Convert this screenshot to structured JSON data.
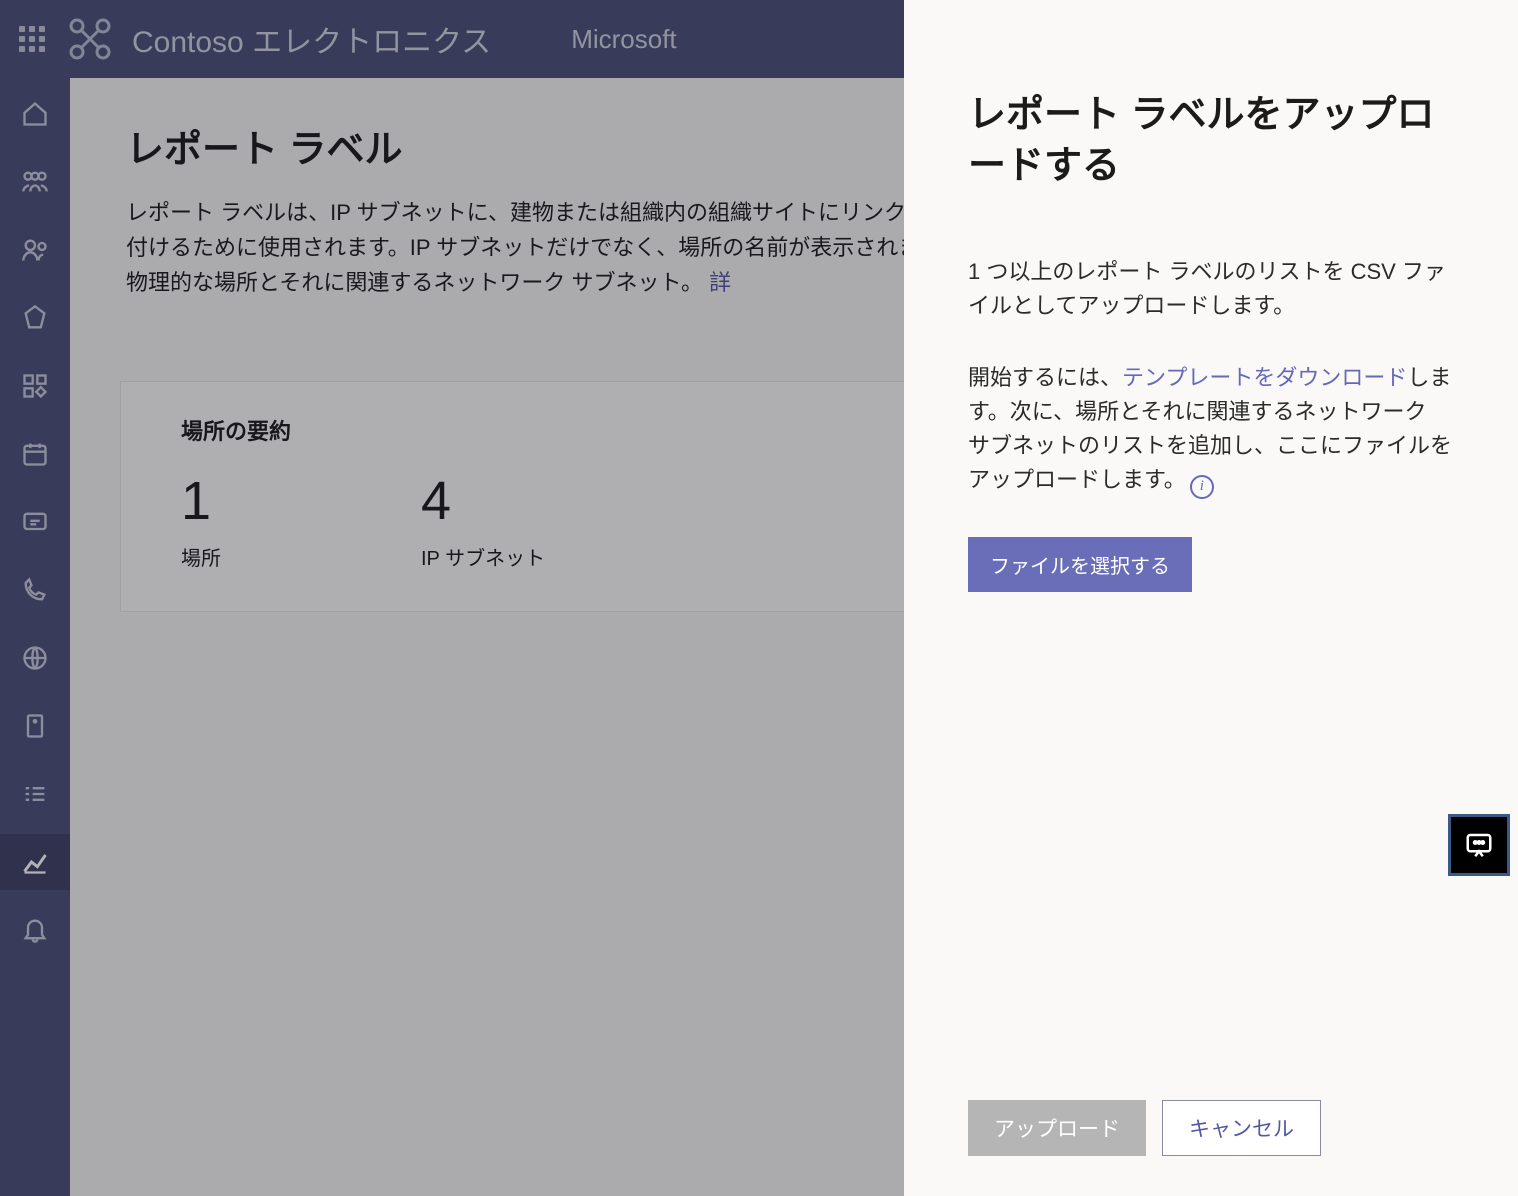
{
  "header": {
    "brand": "Contoso エレクトロニクス",
    "msft": "Microsoft"
  },
  "main": {
    "title": "レポート ラベル",
    "description": "レポート ラベルは、IP サブネットに、建物または組織内の組織サイトにリンクする名前を付けるために使用されます。IP サブネットだけでなく、場所の名前が表示されます。自分物理的な場所とそれに関連するネットワーク サブネット。",
    "details_link": "詳",
    "summary": {
      "title": "場所の要約",
      "stats": [
        {
          "value": "1",
          "label": "場所"
        },
        {
          "value": "4",
          "label": "IP サブネット"
        }
      ]
    }
  },
  "panel": {
    "title": "レポート ラベルをアップロードする",
    "p1": "1 つ以上のレポート ラベルのリストを CSV ファイルとしてアップロードします。",
    "p2_a": "開始するには、",
    "p2_link": "テンプレートをダウンロード",
    "p2_b": "します。次に、場所とそれに関連するネットワーク サブネットのリストを追加し、ここにファイルをアップロードします。",
    "select_file": "ファイルを選択する",
    "upload": "アップロード",
    "cancel": "キャンセル"
  }
}
